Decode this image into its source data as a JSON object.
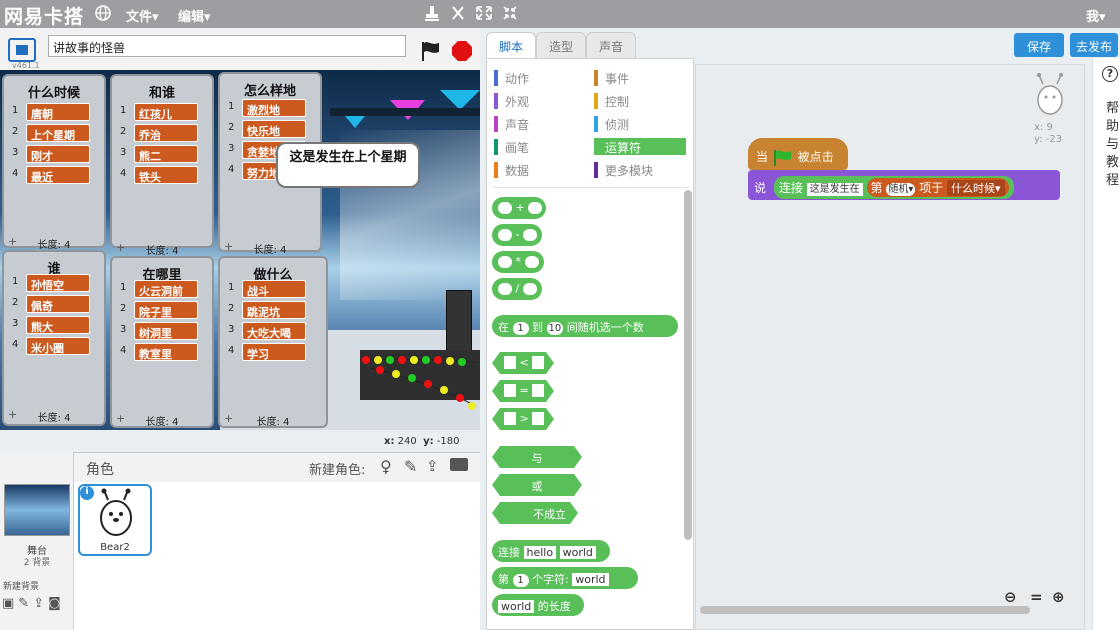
{
  "topbar": {
    "logo": "网易卡搭",
    "menu_file": "文件▾",
    "menu_edit": "编辑▾",
    "user": "我▾"
  },
  "stage": {
    "version": "v461.1",
    "project_title": "讲故事的怪兽",
    "speech": "这是发生在上个星期",
    "coords_x_label": "x:",
    "coords_x": "240",
    "coords_y_label": "y:",
    "coords_y": "-180"
  },
  "lists": [
    {
      "title": "什么时候",
      "items": [
        "唐朝",
        "上个星期",
        "刚才",
        "最近"
      ],
      "length": "长度: 4"
    },
    {
      "title": "和谁",
      "items": [
        "红孩儿",
        "乔治",
        "熊二",
        "铁头"
      ],
      "length": "长度: 4"
    },
    {
      "title": "怎么样地",
      "items": [
        "激烈地",
        "快乐地",
        "贪婪地",
        "努力地"
      ],
      "length": "长度: 4"
    },
    {
      "title": "谁",
      "items": [
        "孙悟空",
        "佩奇",
        "熊大",
        "米小圈"
      ],
      "length": "长度: 4"
    },
    {
      "title": "在哪里",
      "items": [
        "火云洞前",
        "院子里",
        "树洞里",
        "教室里"
      ],
      "length": "长度: 4"
    },
    {
      "title": "做什么",
      "items": [
        "战斗",
        "跳泥坑",
        "大吃大喝",
        "学习"
      ],
      "length": "长度: 4"
    }
  ],
  "sprites": {
    "header": "角色",
    "new_sprite": "新建角色:",
    "stage_label": "舞台",
    "stage_backdrops": "2 背景",
    "new_backdrop": "新建背景",
    "sprite_name": "Bear2"
  },
  "tabs": [
    "脚本",
    "造型",
    "声音"
  ],
  "categories_left": [
    "动作",
    "外观",
    "声音",
    "画笔",
    "数据"
  ],
  "categories_right": [
    "事件",
    "控制",
    "侦测",
    "运算符",
    "更多模块"
  ],
  "category_colors": {
    "动作": "#4a6cd4",
    "外观": "#8a55d7",
    "声音": "#bb42c3",
    "画笔": "#0e9a6c",
    "数据": "#ee7d16",
    "事件": "#c88330",
    "控制": "#e1a91a",
    "侦测": "#2ca5e2",
    "运算符": "#59c059",
    "更多模块": "#632d99"
  },
  "blocks": {
    "plus": "+",
    "minus": "-",
    "times": "*",
    "divide": "/",
    "random_pre": "在",
    "random_a": "1",
    "random_mid": "到",
    "random_b": "10",
    "random_post": "间随机选一个数",
    "lt": "<",
    "eq": "=",
    "gt": ">",
    "and": "与",
    "or": "或",
    "not": "不成立",
    "join_label": "连接",
    "join_a": "hello",
    "join_b": "world",
    "letter_pre": "第",
    "letter_n": "1",
    "letter_mid": "个字符:",
    "letter_s": "world",
    "length_s": "world",
    "length_post": "的长度"
  },
  "script": {
    "hat_pre": "当",
    "hat_post": "被点击",
    "say": "说",
    "join": "连接",
    "join_text": "这是发生在",
    "item_pre": "第",
    "item_index": "随机▾",
    "item_mid": "项于",
    "item_list": "什么时候▾"
  },
  "sprite_info": {
    "x": "x: 9",
    "y": "y: -23"
  },
  "buttons": {
    "save": "保存",
    "share": "去发布"
  },
  "help": {
    "icon": "?",
    "text": "帮助与教程"
  }
}
